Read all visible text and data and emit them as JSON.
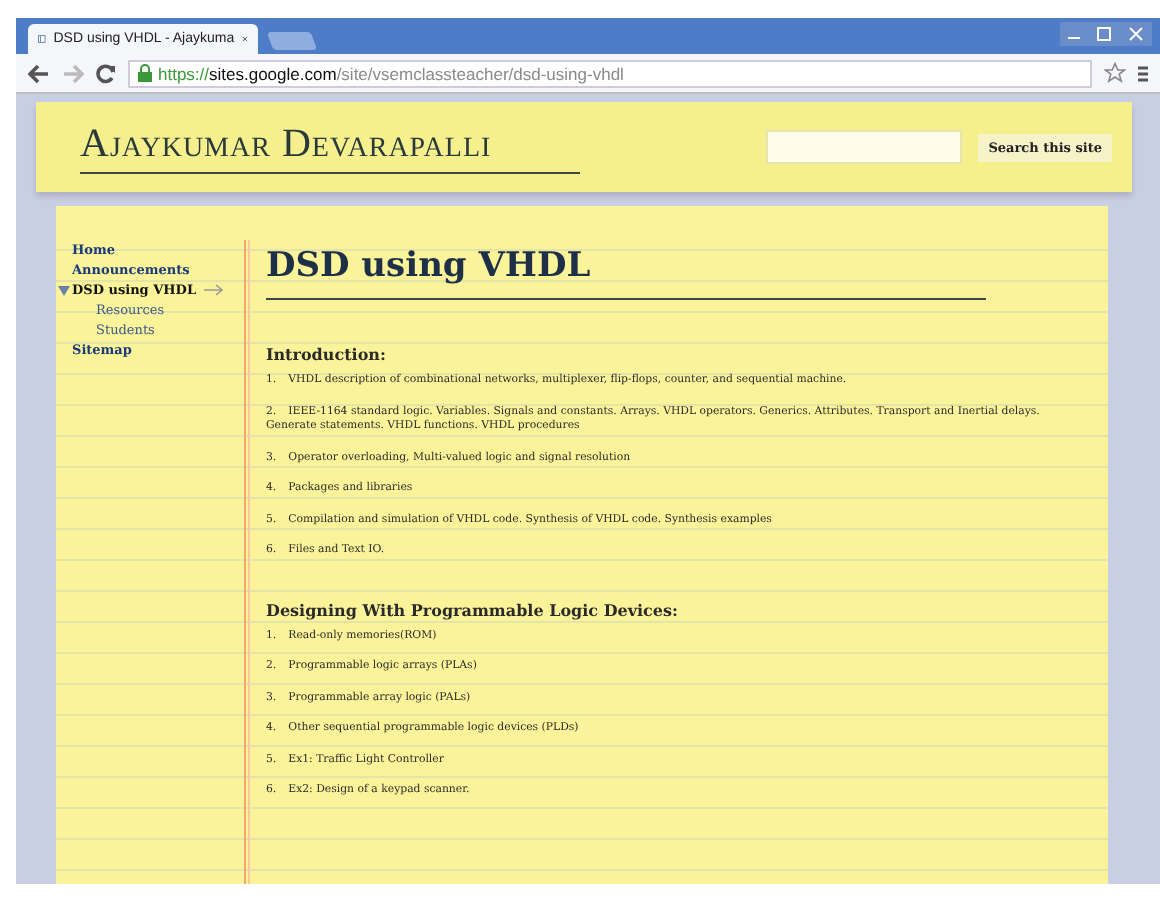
{
  "browser": {
    "tab_title": "DSD using VHDL - Ajaykuma",
    "url": {
      "scheme": "https://",
      "host": "sites.google.com",
      "path": "/site/vsemclassteacher/dsd-using-vhdl"
    }
  },
  "site": {
    "title": "Ajaykumar Devarapalli",
    "search_button": "Search this site"
  },
  "sidebar": {
    "items": [
      {
        "label": "Home",
        "selected": false
      },
      {
        "label": "Announcements",
        "selected": false
      },
      {
        "label": "DSD using VHDL",
        "selected": true,
        "expanded": true,
        "children": [
          {
            "label": "Resources",
            "selected": false
          },
          {
            "label": "Students",
            "selected": false
          }
        ]
      },
      {
        "label": "Sitemap",
        "selected": false
      }
    ]
  },
  "page": {
    "title": "DSD using VHDL",
    "sections": [
      {
        "heading": "Introduction:",
        "items": [
          {
            "number": "1.",
            "text": "VHDL description of combinational networks, multiplexer, flip-flops, counter, and sequential machine."
          },
          {
            "number": "2.",
            "text": "IEEE-1164 standard logic. Variables. Signals and constants. Arrays. VHDL operators. Generics. Attributes. Transport and Inertial delays. Generate statements. VHDL functions. VHDL procedures"
          },
          {
            "number": "3.",
            "text": "Operator overloading, Multi-valued logic and signal resolution"
          },
          {
            "number": "4.",
            "text": "Packages and libraries"
          },
          {
            "number": "5.",
            "text": "Compilation and simulation of VHDL code. Synthesis of VHDL code. Synthesis examples"
          },
          {
            "number": "6.",
            "text": "Files and Text IO."
          }
        ]
      },
      {
        "heading": "Designing With Programmable Logic Devices:",
        "items": [
          {
            "number": "1.",
            "text": "Read-only memories(ROM)"
          },
          {
            "number": "2.",
            "text": "Programmable logic arrays (PLAs)"
          },
          {
            "number": "3.",
            "text": "Programmable array logic (PALs)"
          },
          {
            "number": "4.",
            "text": "Other sequential programmable logic devices (PLDs)"
          },
          {
            "number": "5.",
            "text": "Ex1: Traffic Light Controller"
          },
          {
            "number": "6.",
            "text": "Ex2: Design of a keypad scanner."
          }
        ]
      }
    ]
  }
}
